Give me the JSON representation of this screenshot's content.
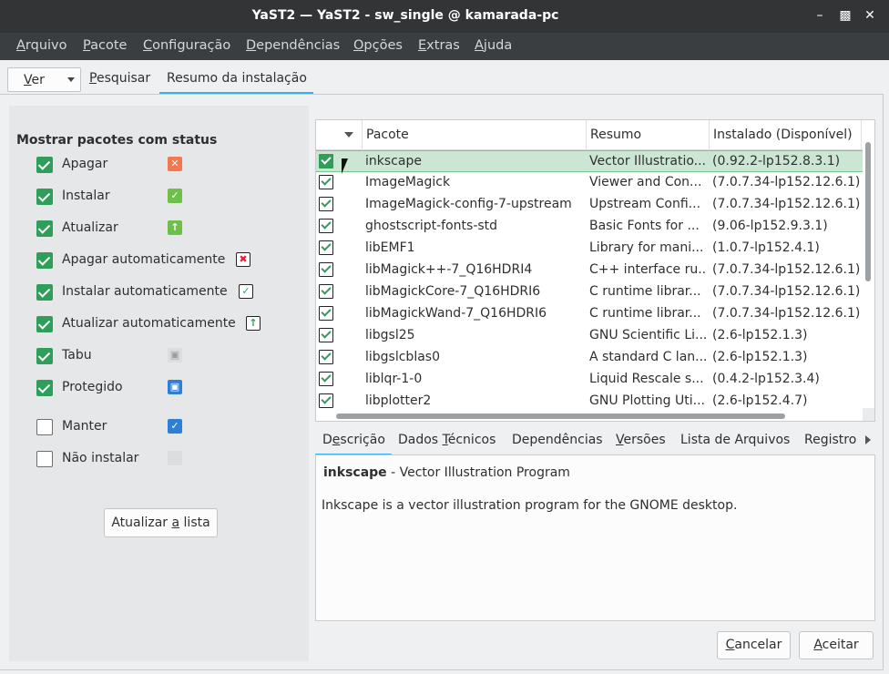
{
  "window": {
    "title": "YaST2 — YaST2 - sw_single @ kamarada-pc"
  },
  "menu": [
    {
      "pre": "",
      "m": "A",
      "post": "rquivo"
    },
    {
      "pre": "",
      "m": "P",
      "post": "acote"
    },
    {
      "pre": "",
      "m": "C",
      "post": "onfiguração"
    },
    {
      "pre": "",
      "m": "D",
      "post": "ependências"
    },
    {
      "pre": "",
      "m": "O",
      "post": "pções"
    },
    {
      "pre": "",
      "m": "E",
      "post": "xtras"
    },
    {
      "pre": "",
      "m": "A",
      "post": "juda"
    }
  ],
  "view_button": {
    "m": "V",
    "post": "er"
  },
  "top_tabs": {
    "search": {
      "m": "P",
      "post": "esquisar"
    },
    "summary": "Resumo da instalação"
  },
  "left": {
    "title": "Mostrar pacotes com status",
    "filters": [
      {
        "label": "Apagar",
        "checked": true,
        "icon": "delete-icon"
      },
      {
        "label": "Instalar",
        "checked": true,
        "icon": "install-icon"
      },
      {
        "label": "Atualizar",
        "checked": true,
        "icon": "update-icon"
      },
      {
        "label": "Apagar automaticamente",
        "checked": true,
        "icon": "auto-delete-icon"
      },
      {
        "label": "Instalar automaticamente",
        "checked": true,
        "icon": "auto-install-icon"
      },
      {
        "label": "Atualizar automaticamente",
        "checked": true,
        "icon": "auto-update-icon"
      },
      {
        "label": "Tabu",
        "checked": true,
        "icon": "taboo-lock-icon"
      },
      {
        "label": "Protegido",
        "checked": true,
        "icon": "protected-lock-icon"
      },
      {
        "label": "Manter",
        "checked": false,
        "icon": "keep-check-icon"
      },
      {
        "label": "Não instalar",
        "checked": false,
        "icon": "no-install-icon"
      }
    ],
    "refresh": {
      "pre": "Atualizar ",
      "m": "a",
      "post": " lista"
    }
  },
  "table": {
    "headers": [
      "Pacote",
      "Resumo",
      "Instalado (Disponível)"
    ],
    "rows": [
      {
        "name": "inkscape",
        "summary": "Vector Illustratio...",
        "version": "(0.92.2-lp152.8.3.1)"
      },
      {
        "name": "ImageMagick",
        "summary": "Viewer and Con...",
        "version": "(7.0.7.34-lp152.12.6.1)"
      },
      {
        "name": "ImageMagick-config-7-upstream",
        "summary": "Upstream Confi...",
        "version": "(7.0.7.34-lp152.12.6.1)"
      },
      {
        "name": "ghostscript-fonts-std",
        "summary": "Basic Fonts for ...",
        "version": "(9.06-lp152.9.3.1)"
      },
      {
        "name": "libEMF1",
        "summary": "Library for mani...",
        "version": "(1.0.7-lp152.4.1)"
      },
      {
        "name": "libMagick++-7_Q16HDRI4",
        "summary": "C++ interface ru...",
        "version": "(7.0.7.34-lp152.12.6.1)"
      },
      {
        "name": "libMagickCore-7_Q16HDRI6",
        "summary": "C runtime librar...",
        "version": "(7.0.7.34-lp152.12.6.1)"
      },
      {
        "name": "libMagickWand-7_Q16HDRI6",
        "summary": "C runtime librar...",
        "version": "(7.0.7.34-lp152.12.6.1)"
      },
      {
        "name": "libgsl25",
        "summary": "GNU Scientific Li...",
        "version": "(2.6-lp152.1.3)"
      },
      {
        "name": "libgslcblas0",
        "summary": "A standard C lan...",
        "version": "(2.6-lp152.1.3)"
      },
      {
        "name": "liblqr-1-0",
        "summary": "Liquid Rescale s...",
        "version": "(0.4.2-lp152.3.4)"
      },
      {
        "name": "libplotter2",
        "summary": "GNU Plotting Uti...",
        "version": "(2.6-lp152.4.7)"
      }
    ]
  },
  "detail_tabs": [
    {
      "pre": "D",
      "m": "e",
      "post": "scrição"
    },
    {
      "pre": "Dados ",
      "m": "T",
      "post": "écnicos"
    },
    {
      "pre": "Dependências",
      "m": "",
      "post": ""
    },
    {
      "pre": "",
      "m": "V",
      "post": "ersões"
    },
    {
      "pre": "Lista de Arquivos",
      "m": "",
      "post": ""
    },
    {
      "pre": "Registro de",
      "m": "",
      "post": ""
    }
  ],
  "description": {
    "name": "inkscape",
    "summary": " - Vector Illustration Program",
    "body": "Inkscape is a vector illustration program for the GNOME desktop."
  },
  "buttons": {
    "cancel": {
      "m": "C",
      "post": "ancelar"
    },
    "accept": {
      "m": "A",
      "post": "ceitar"
    }
  },
  "colors": {
    "accent": "#3daee9",
    "check_green": "#2f9e5a",
    "selected_row": "#cbe7d3"
  }
}
